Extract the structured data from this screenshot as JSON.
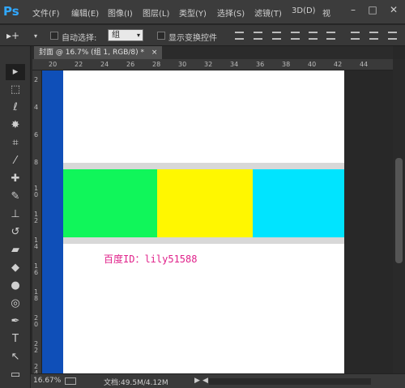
{
  "app": {
    "logo": "Ps"
  },
  "menu": [
    "文件(F)",
    "编辑(E)",
    "图像(I)",
    "图层(L)",
    "类型(Y)",
    "选择(S)",
    "滤镜(T)",
    "3D(D)",
    "视"
  ],
  "window_controls": {
    "minimize": "–",
    "restore": "□",
    "close": "✕"
  },
  "options": {
    "move_tool_icon": "▸+",
    "dropdown_arrow": "▾",
    "auto_select_label": "自动选择:",
    "auto_select_value": "组",
    "show_transform_label": "显示变换控件"
  },
  "document_tab": {
    "label": "封面 @ 16.7% (组 1, RGB/8) *",
    "close": "×"
  },
  "tools": [
    {
      "name": "move-tool-icon",
      "glyph": "▸"
    },
    {
      "name": "marquee-tool-icon",
      "glyph": "⬚"
    },
    {
      "name": "lasso-tool-icon",
      "glyph": "ℓ"
    },
    {
      "name": "magic-wand-tool-icon",
      "glyph": "✸"
    },
    {
      "name": "crop-tool-icon",
      "glyph": "⌗"
    },
    {
      "name": "eyedropper-tool-icon",
      "glyph": "⁄"
    },
    {
      "name": "healing-brush-tool-icon",
      "glyph": "✚"
    },
    {
      "name": "brush-tool-icon",
      "glyph": "✎"
    },
    {
      "name": "stamp-tool-icon",
      "glyph": "⊥"
    },
    {
      "name": "history-brush-tool-icon",
      "glyph": "↺"
    },
    {
      "name": "eraser-tool-icon",
      "glyph": "▰"
    },
    {
      "name": "paint-bucket-tool-icon",
      "glyph": "◆"
    },
    {
      "name": "blur-tool-icon",
      "glyph": "●"
    },
    {
      "name": "dodge-tool-icon",
      "glyph": "◎"
    },
    {
      "name": "pen-tool-icon",
      "glyph": "✒"
    },
    {
      "name": "type-tool-icon",
      "glyph": "T"
    },
    {
      "name": "path-selection-tool-icon",
      "glyph": "↖"
    },
    {
      "name": "rectangle-tool-icon",
      "glyph": "▭"
    }
  ],
  "ruler_top": [
    "20",
    "22",
    "24",
    "26",
    "28",
    "30",
    "32",
    "34",
    "36",
    "38",
    "40",
    "42",
    "44"
  ],
  "ruler_left": [
    "2",
    "4",
    "6",
    "8",
    "1\n0",
    "1\n2",
    "1\n4",
    "1\n6",
    "1\n8",
    "2\n0",
    "2\n2",
    "2\n4"
  ],
  "canvas": {
    "strip_color": "#0f4fb8",
    "band_color": "#d8d8d8",
    "blocks": [
      {
        "color": "#10f65a"
      },
      {
        "color": "#fff700"
      },
      {
        "color": "#00e4ff"
      }
    ],
    "watermark": "百度ID：lily51588"
  },
  "status": {
    "zoom": "16.67%",
    "doc_info": "文档:49.5M/4.12M",
    "arrow_right": "▶",
    "arrow_left": "◀"
  }
}
